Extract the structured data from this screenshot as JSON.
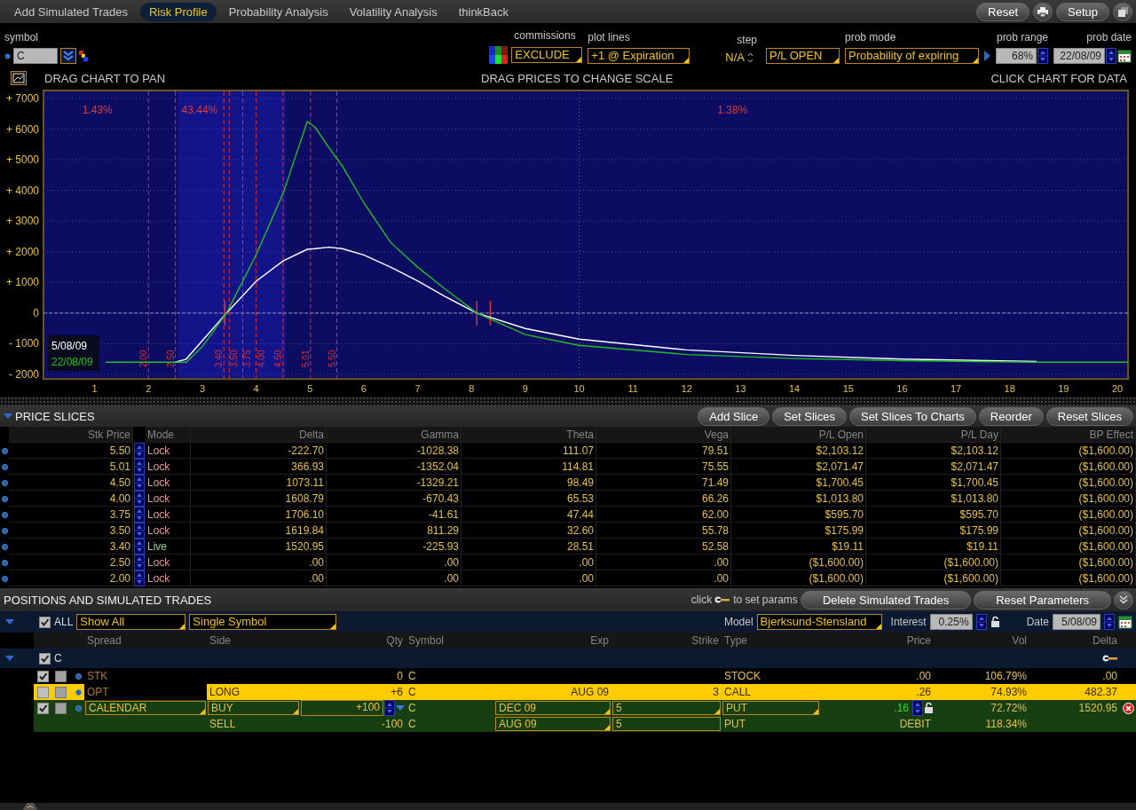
{
  "tabs": [
    {
      "label": "Add Simulated Trades",
      "selected": false
    },
    {
      "label": "Risk Profile",
      "selected": true
    },
    {
      "label": "Probability Analysis",
      "selected": false
    },
    {
      "label": "Volatility Analysis",
      "selected": false
    },
    {
      "label": "thinkBack",
      "selected": false
    }
  ],
  "toolbar_buttons": [
    {
      "kind": "text",
      "label": "Reset"
    },
    {
      "kind": "print"
    },
    {
      "kind": "text",
      "label": "Setup"
    },
    {
      "kind": "window"
    }
  ],
  "params": {
    "symbol": {
      "label": "symbol",
      "value": "C"
    },
    "commissions": {
      "label": "commissions",
      "value": "EXCLUDE"
    },
    "plot_lines": {
      "label": "plot lines",
      "value": "+1 @ Expiration"
    },
    "step": {
      "label": "step",
      "value": "N/A"
    },
    "step_mode": {
      "value": "P/L OPEN"
    },
    "prob_mode": {
      "label": "prob mode",
      "value": "Probability of expiring"
    },
    "prob_range": {
      "label": "prob range",
      "value": "68%"
    },
    "prob_date": {
      "label": "prob date",
      "value": "22/08/09"
    }
  },
  "chart_hints": [
    "DRAG CHART TO PAN",
    "DRAG PRICES TO CHANGE SCALE",
    "CLICK CHART FOR DATA"
  ],
  "chart": {
    "probability_labels": [
      "1.43%",
      "43.44%",
      "1.38%"
    ],
    "slice_labels": [
      "2.00",
      "2.50",
      "3.40",
      "3.50",
      "3.75",
      "4.00",
      "4.50",
      "5.01",
      "5.50"
    ],
    "chart_data": {
      "type": "line",
      "x": [
        1.2,
        2,
        2.5,
        2.7,
        3,
        3.45,
        4,
        4.5,
        4.95,
        5.1,
        5.35,
        5.6,
        6,
        6.5,
        7,
        7.5,
        8.1,
        9,
        10,
        12,
        14,
        16,
        18.5,
        20.2
      ],
      "series": [
        {
          "name": "5/08/09",
          "color": "#ffffff",
          "values": [
            null,
            null,
            -1600,
            -1500,
            -900,
            0,
            1040,
            1700,
            2080,
            2100,
            2150,
            2100,
            1900,
            1500,
            1050,
            550,
            0,
            -500,
            -850,
            -1200,
            -1380,
            -1500,
            -1580,
            null
          ]
        },
        {
          "name": "22/08/09",
          "color": "#20c020",
          "values": [
            -1600,
            -1600,
            -1600,
            -1600,
            -1100,
            0,
            1900,
            3900,
            6250,
            6050,
            5400,
            4800,
            3600,
            2300,
            1500,
            800,
            0,
            -700,
            -1050,
            -1350,
            -1480,
            -1550,
            -1600,
            -1600
          ]
        }
      ],
      "xlim": [
        0.05,
        20.2
      ],
      "ylim": [
        -2150,
        7260
      ],
      "grid": true,
      "ref_lines": [
        {
          "axis": "y",
          "value": 0
        },
        {
          "axis": "x",
          "value": 10
        }
      ],
      "xticks": [
        1,
        2,
        3,
        4,
        5,
        6,
        7,
        8,
        9,
        10,
        11,
        12,
        13,
        14,
        15,
        16,
        17,
        18,
        19,
        20
      ],
      "yticks": [
        {
          "value": 7000,
          "label": "+ 7000"
        },
        {
          "value": 6000,
          "label": "+ 6000"
        },
        {
          "value": 5000,
          "label": "+ 5000"
        },
        {
          "value": 4000,
          "label": "+ 4000"
        },
        {
          "value": 3000,
          "label": "+ 3000"
        },
        {
          "value": 2000,
          "label": "+ 2000"
        },
        {
          "value": 1000,
          "label": "+ 1000"
        },
        {
          "value": 0,
          "label": "0"
        },
        {
          "value": -1000,
          "label": "- 1000"
        },
        {
          "value": -2000,
          "label": "- 2000"
        }
      ]
    }
  },
  "price_slices": {
    "title": "PRICE SLICES",
    "buttons": [
      "Add Slice",
      "Set Slices",
      "Set Slices To Charts",
      "Reorder",
      "Reset Slices"
    ],
    "columns": [
      "Stk Price",
      "Mode",
      "Delta",
      "Gamma",
      "Theta",
      "Vega",
      "P/L Open",
      "P/L Day",
      "BP Effect"
    ],
    "rows": [
      {
        "stk_price": "5.50",
        "mode": "Lock",
        "live": false,
        "values": [
          "-222.70",
          "-1028.38",
          "111.07",
          "79.51",
          "$2,103.12",
          "$2,103.12",
          "($1,600.00)"
        ]
      },
      {
        "stk_price": "5.01",
        "mode": "Lock",
        "live": false,
        "values": [
          "366.93",
          "-1352.04",
          "114.81",
          "75.55",
          "$2,071.47",
          "$2,071.47",
          "($1,600.00)"
        ]
      },
      {
        "stk_price": "4.50",
        "mode": "Lock",
        "live": false,
        "values": [
          "1073.11",
          "-1329.21",
          "98.49",
          "71.49",
          "$1,700.45",
          "$1,700.45",
          "($1,600.00)"
        ]
      },
      {
        "stk_price": "4.00",
        "mode": "Lock",
        "live": false,
        "values": [
          "1608.79",
          "-670.43",
          "65.53",
          "66.26",
          "$1,013.80",
          "$1,013.80",
          "($1,600.00)"
        ]
      },
      {
        "stk_price": "3.75",
        "mode": "Lock",
        "live": false,
        "values": [
          "1706.10",
          "-41.61",
          "47.44",
          "62.00",
          "$595.70",
          "$595.70",
          "($1,600.00)"
        ]
      },
      {
        "stk_price": "3.50",
        "mode": "Lock",
        "live": false,
        "values": [
          "1619.84",
          "811.29",
          "32.60",
          "55.78",
          "$175.99",
          "$175.99",
          "($1,600.00)"
        ]
      },
      {
        "stk_price": "3.40",
        "mode": "Live",
        "live": true,
        "values": [
          "1520.95",
          "-225.93",
          "28.51",
          "52.58",
          "$19.11",
          "$19.11",
          "($1,600.00)"
        ]
      },
      {
        "stk_price": "2.50",
        "mode": "Lock",
        "live": false,
        "values": [
          ".00",
          ".00",
          ".00",
          ".00",
          "($1,600.00)",
          "($1,600.00)",
          "($1,600.00)"
        ]
      },
      {
        "stk_price": "2.00",
        "mode": "Lock",
        "live": false,
        "values": [
          ".00",
          ".00",
          ".00",
          ".00",
          "($1,600.00)",
          "($1,600.00)",
          "($1,600.00)"
        ]
      }
    ]
  },
  "positions": {
    "title": "POSITIONS AND SIMULATED TRADES",
    "hint_before": "click",
    "hint_after": "to set params",
    "buttons": [
      "Delete Simulated Trades",
      "Reset Parameters"
    ],
    "all": {
      "label": "ALL",
      "checked": true
    },
    "filter": "Show All",
    "scope": "Single Symbol",
    "model": {
      "label": "Model",
      "value": "Bjerksund-Stensland"
    },
    "interest": {
      "label": "Interest",
      "value": "0.25%"
    },
    "date": {
      "label": "Date",
      "value": "5/08/09"
    },
    "columns": [
      "Spread",
      "Side",
      "Qty",
      "Symbol",
      "Exp",
      "Strike",
      "Type",
      "Price",
      "Vol",
      "Delta"
    ],
    "group": {
      "label": "C",
      "checked": true,
      "expanded": true
    },
    "rows": [
      {
        "kind": "stock",
        "checked": true,
        "selected": false,
        "cells": [
          "STK",
          null,
          "0",
          "C",
          null,
          null,
          "STOCK",
          ".00",
          "106.79%",
          ".00"
        ]
      },
      {
        "kind": "option",
        "checked": false,
        "selected": true,
        "cells": [
          "OPT",
          "LONG",
          "+6",
          "C",
          "AUG 09",
          "3",
          "CALL",
          ".26",
          "74.93%",
          "482.37"
        ]
      },
      {
        "kind": "spread",
        "checked": true,
        "selected": false,
        "cells": [
          "CALENDAR",
          "BUY",
          "+100",
          "C",
          "DEC 09",
          "5",
          "PUT",
          ".16",
          "72.72%",
          "1520.95"
        ]
      },
      {
        "kind": "leg",
        "selected": false,
        "cells": [
          null,
          "SELL",
          "-100",
          "C",
          "AUG 09",
          "5",
          "PUT",
          "DEBIT",
          "118.34%",
          null
        ]
      }
    ]
  }
}
